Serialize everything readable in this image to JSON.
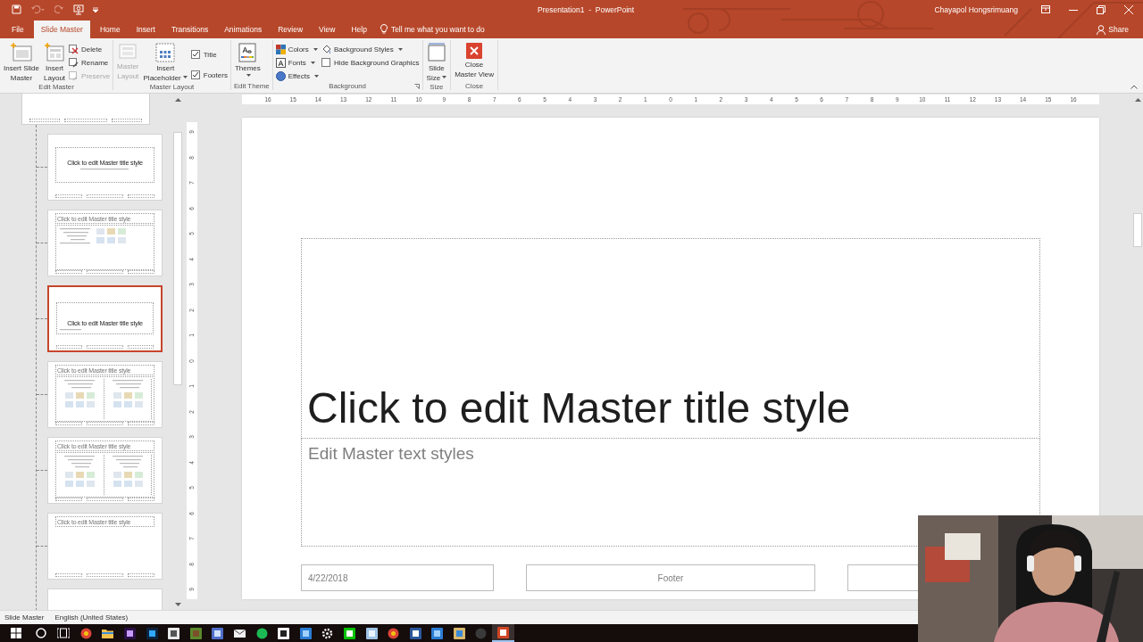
{
  "window": {
    "title": "Presentation1  -  PowerPoint",
    "user": "Chayapol Hongsrimuang"
  },
  "tabs": [
    {
      "label": "File",
      "selected": false
    },
    {
      "label": "Slide Master",
      "selected": true
    },
    {
      "label": "Home",
      "selected": false
    },
    {
      "label": "Insert",
      "selected": false
    },
    {
      "label": "Transitions",
      "selected": false
    },
    {
      "label": "Animations",
      "selected": false
    },
    {
      "label": "Review",
      "selected": false
    },
    {
      "label": "View",
      "selected": false
    },
    {
      "label": "Help",
      "selected": false
    }
  ],
  "tell_me": "Tell me what you want to do",
  "share": "Share",
  "ribbon": {
    "edit_master": {
      "label": "Edit Master",
      "insert_slide_master": "Insert Slide\nMaster",
      "insert_layout": "Insert\nLayout",
      "delete": "Delete",
      "rename": "Rename",
      "preserve": {
        "label": "Preserve",
        "disabled": true
      }
    },
    "master_layout": {
      "label": "Master Layout",
      "master_layout": {
        "label": "Master\nLayout",
        "disabled": true
      },
      "insert_placeholder": "Insert\nPlaceholder",
      "title": {
        "label": "Title",
        "checked": true
      },
      "footers": {
        "label": "Footers",
        "checked": true
      }
    },
    "edit_theme": {
      "label": "Edit Theme",
      "themes": "Themes"
    },
    "background": {
      "label": "Background",
      "colors": "Colors",
      "fonts": "Fonts",
      "effects": "Effects",
      "background_styles": "Background Styles",
      "hide_background_graphics": {
        "label": "Hide Background Graphics",
        "checked": false
      }
    },
    "size": {
      "label": "Size",
      "slide_size": "Slide\nSize"
    },
    "close": {
      "label": "Close",
      "close_master_view": "Close\nMaster View"
    }
  },
  "thumbnails": [
    {
      "kind": "master",
      "selected": false
    },
    {
      "kind": "title",
      "title": "Click to edit Master title style",
      "selected": false
    },
    {
      "kind": "content",
      "title": "Click to edit Master title style",
      "selected": false
    },
    {
      "kind": "section",
      "title": "Click to edit Master title style",
      "selected": true
    },
    {
      "kind": "two_content",
      "title": "Click to edit Master title style",
      "selected": false
    },
    {
      "kind": "comparison",
      "title": "Click to edit Master title style",
      "selected": false
    },
    {
      "kind": "title_only",
      "title": "Click to edit Master title style",
      "selected": false
    },
    {
      "kind": "blank",
      "selected": false
    }
  ],
  "rulers": {
    "horizontal": [
      "16",
      "15",
      "14",
      "13",
      "12",
      "11",
      "10",
      "9",
      "8",
      "7",
      "6",
      "5",
      "4",
      "3",
      "2",
      "1",
      "0",
      "1",
      "2",
      "3",
      "4",
      "5",
      "6",
      "7",
      "8",
      "9",
      "10",
      "11",
      "12",
      "13",
      "14",
      "15",
      "16"
    ],
    "vertical": [
      "9",
      "8",
      "7",
      "6",
      "5",
      "4",
      "3",
      "2",
      "1",
      "0",
      "1",
      "2",
      "3",
      "4",
      "5",
      "6",
      "7",
      "8",
      "9"
    ]
  },
  "slide": {
    "title": "Click to edit Master title style",
    "text": "Edit Master text styles",
    "date": "4/22/2018",
    "footer": "Footer"
  },
  "status_bar": {
    "view": "Slide Master",
    "language": "English (United States)"
  },
  "taskbar": [
    {
      "kind": "browser",
      "active": false
    },
    {
      "kind": "folder",
      "active": false
    },
    {
      "kind": "purple",
      "active": false
    },
    {
      "kind": "navy",
      "active": false
    },
    {
      "kind": "bag",
      "active": false
    },
    {
      "kind": "block",
      "active": false
    },
    {
      "kind": "window",
      "active": false
    },
    {
      "kind": "mail",
      "active": false
    },
    {
      "kind": "music",
      "active": false
    },
    {
      "kind": "note",
      "active": false
    },
    {
      "kind": "remote",
      "active": false
    },
    {
      "kind": "settings",
      "active": false
    },
    {
      "kind": "chat",
      "active": false
    },
    {
      "kind": "notepad",
      "active": false
    },
    {
      "kind": "browser",
      "active": false
    },
    {
      "kind": "word",
      "active": false
    },
    {
      "kind": "remote",
      "active": false
    },
    {
      "kind": "paint",
      "active": false
    },
    {
      "kind": "record",
      "active": false
    },
    {
      "kind": "slides",
      "active": true
    }
  ]
}
